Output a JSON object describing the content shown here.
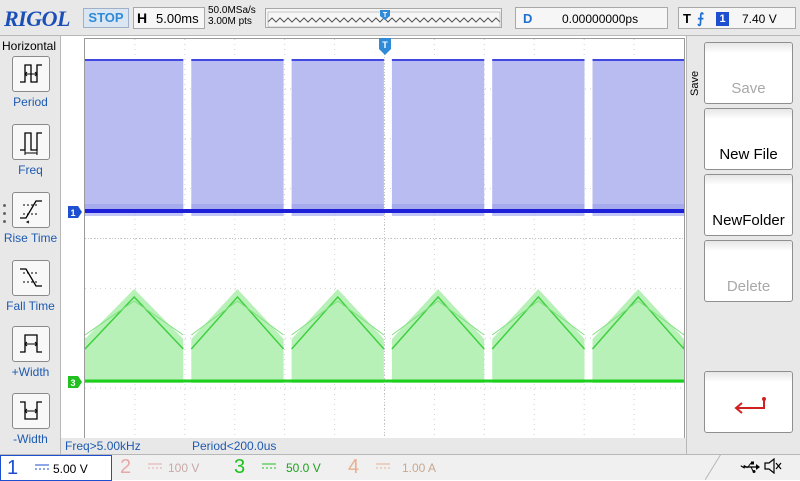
{
  "brand": "RIGOL",
  "run_status": "STOP",
  "horizontal": {
    "label": "H",
    "timebase": "5.00ms"
  },
  "acquisition": {
    "sample_rate": "50.0MSa/s",
    "memory_depth": "3.00M pts"
  },
  "delay": {
    "label": "D",
    "value": "0.00000000ps"
  },
  "trigger": {
    "label": "T",
    "edge_icon": "rising-edge-icon",
    "source": "1",
    "level": "7.40 V"
  },
  "trigger_marker": "T",
  "left_menu": {
    "title": "Horizontal",
    "items": [
      {
        "label": "Period"
      },
      {
        "label": "Freq"
      },
      {
        "label": "Rise Time"
      },
      {
        "label": "Fall Time"
      },
      {
        "label": "+Width"
      },
      {
        "label": "-Width"
      }
    ]
  },
  "right_menu": {
    "title": "Save",
    "items": [
      {
        "label": "Save",
        "enabled": false
      },
      {
        "label": "New File",
        "enabled": true
      },
      {
        "label": "NewFolder",
        "enabled": true
      },
      {
        "label": "Delete",
        "enabled": false
      },
      {
        "label": "",
        "icon": "enter-arrow-icon",
        "enabled": true
      }
    ]
  },
  "channel_markers": {
    "ch1": "1",
    "ch3": "3"
  },
  "measurements": {
    "freq": "Freq>5.00kHz",
    "period": "Period<200.0us"
  },
  "channels": [
    {
      "number": "1",
      "scale": "5.00 V",
      "color": "#1d4fd0",
      "active": true
    },
    {
      "number": "2",
      "scale": "100 V",
      "color": "#e8a8a8",
      "active": false
    },
    {
      "number": "3",
      "scale": "50.0 V",
      "color": "#20c020",
      "active": true
    },
    {
      "number": "4",
      "scale": "1.00 A",
      "color": "#e8b090",
      "active": false
    }
  ],
  "status_icons": [
    "usb-icon",
    "speaker-muted-icon"
  ],
  "colors": {
    "ch1_trace": "#1d1fd8",
    "ch1_envelope": "#b4b8f0",
    "ch3_trace": "#1ed01e",
    "ch3_envelope": "#b4f0b4",
    "accent": "#1d6fd0"
  }
}
